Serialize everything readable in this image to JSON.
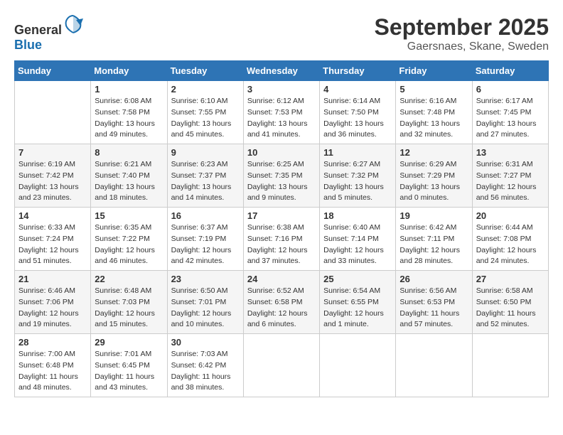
{
  "header": {
    "logo_general": "General",
    "logo_blue": "Blue",
    "month": "September 2025",
    "location": "Gaersnaes, Skane, Sweden"
  },
  "days_of_week": [
    "Sunday",
    "Monday",
    "Tuesday",
    "Wednesday",
    "Thursday",
    "Friday",
    "Saturday"
  ],
  "weeks": [
    [
      {
        "day": "",
        "sunrise": "",
        "sunset": "",
        "daylight": ""
      },
      {
        "day": "1",
        "sunrise": "Sunrise: 6:08 AM",
        "sunset": "Sunset: 7:58 PM",
        "daylight": "Daylight: 13 hours and 49 minutes."
      },
      {
        "day": "2",
        "sunrise": "Sunrise: 6:10 AM",
        "sunset": "Sunset: 7:55 PM",
        "daylight": "Daylight: 13 hours and 45 minutes."
      },
      {
        "day": "3",
        "sunrise": "Sunrise: 6:12 AM",
        "sunset": "Sunset: 7:53 PM",
        "daylight": "Daylight: 13 hours and 41 minutes."
      },
      {
        "day": "4",
        "sunrise": "Sunrise: 6:14 AM",
        "sunset": "Sunset: 7:50 PM",
        "daylight": "Daylight: 13 hours and 36 minutes."
      },
      {
        "day": "5",
        "sunrise": "Sunrise: 6:16 AM",
        "sunset": "Sunset: 7:48 PM",
        "daylight": "Daylight: 13 hours and 32 minutes."
      },
      {
        "day": "6",
        "sunrise": "Sunrise: 6:17 AM",
        "sunset": "Sunset: 7:45 PM",
        "daylight": "Daylight: 13 hours and 27 minutes."
      }
    ],
    [
      {
        "day": "7",
        "sunrise": "Sunrise: 6:19 AM",
        "sunset": "Sunset: 7:42 PM",
        "daylight": "Daylight: 13 hours and 23 minutes."
      },
      {
        "day": "8",
        "sunrise": "Sunrise: 6:21 AM",
        "sunset": "Sunset: 7:40 PM",
        "daylight": "Daylight: 13 hours and 18 minutes."
      },
      {
        "day": "9",
        "sunrise": "Sunrise: 6:23 AM",
        "sunset": "Sunset: 7:37 PM",
        "daylight": "Daylight: 13 hours and 14 minutes."
      },
      {
        "day": "10",
        "sunrise": "Sunrise: 6:25 AM",
        "sunset": "Sunset: 7:35 PM",
        "daylight": "Daylight: 13 hours and 9 minutes."
      },
      {
        "day": "11",
        "sunrise": "Sunrise: 6:27 AM",
        "sunset": "Sunset: 7:32 PM",
        "daylight": "Daylight: 13 hours and 5 minutes."
      },
      {
        "day": "12",
        "sunrise": "Sunrise: 6:29 AM",
        "sunset": "Sunset: 7:29 PM",
        "daylight": "Daylight: 13 hours and 0 minutes."
      },
      {
        "day": "13",
        "sunrise": "Sunrise: 6:31 AM",
        "sunset": "Sunset: 7:27 PM",
        "daylight": "Daylight: 12 hours and 56 minutes."
      }
    ],
    [
      {
        "day": "14",
        "sunrise": "Sunrise: 6:33 AM",
        "sunset": "Sunset: 7:24 PM",
        "daylight": "Daylight: 12 hours and 51 minutes."
      },
      {
        "day": "15",
        "sunrise": "Sunrise: 6:35 AM",
        "sunset": "Sunset: 7:22 PM",
        "daylight": "Daylight: 12 hours and 46 minutes."
      },
      {
        "day": "16",
        "sunrise": "Sunrise: 6:37 AM",
        "sunset": "Sunset: 7:19 PM",
        "daylight": "Daylight: 12 hours and 42 minutes."
      },
      {
        "day": "17",
        "sunrise": "Sunrise: 6:38 AM",
        "sunset": "Sunset: 7:16 PM",
        "daylight": "Daylight: 12 hours and 37 minutes."
      },
      {
        "day": "18",
        "sunrise": "Sunrise: 6:40 AM",
        "sunset": "Sunset: 7:14 PM",
        "daylight": "Daylight: 12 hours and 33 minutes."
      },
      {
        "day": "19",
        "sunrise": "Sunrise: 6:42 AM",
        "sunset": "Sunset: 7:11 PM",
        "daylight": "Daylight: 12 hours and 28 minutes."
      },
      {
        "day": "20",
        "sunrise": "Sunrise: 6:44 AM",
        "sunset": "Sunset: 7:08 PM",
        "daylight": "Daylight: 12 hours and 24 minutes."
      }
    ],
    [
      {
        "day": "21",
        "sunrise": "Sunrise: 6:46 AM",
        "sunset": "Sunset: 7:06 PM",
        "daylight": "Daylight: 12 hours and 19 minutes."
      },
      {
        "day": "22",
        "sunrise": "Sunrise: 6:48 AM",
        "sunset": "Sunset: 7:03 PM",
        "daylight": "Daylight: 12 hours and 15 minutes."
      },
      {
        "day": "23",
        "sunrise": "Sunrise: 6:50 AM",
        "sunset": "Sunset: 7:01 PM",
        "daylight": "Daylight: 12 hours and 10 minutes."
      },
      {
        "day": "24",
        "sunrise": "Sunrise: 6:52 AM",
        "sunset": "Sunset: 6:58 PM",
        "daylight": "Daylight: 12 hours and 6 minutes."
      },
      {
        "day": "25",
        "sunrise": "Sunrise: 6:54 AM",
        "sunset": "Sunset: 6:55 PM",
        "daylight": "Daylight: 12 hours and 1 minute."
      },
      {
        "day": "26",
        "sunrise": "Sunrise: 6:56 AM",
        "sunset": "Sunset: 6:53 PM",
        "daylight": "Daylight: 11 hours and 57 minutes."
      },
      {
        "day": "27",
        "sunrise": "Sunrise: 6:58 AM",
        "sunset": "Sunset: 6:50 PM",
        "daylight": "Daylight: 11 hours and 52 minutes."
      }
    ],
    [
      {
        "day": "28",
        "sunrise": "Sunrise: 7:00 AM",
        "sunset": "Sunset: 6:48 PM",
        "daylight": "Daylight: 11 hours and 48 minutes."
      },
      {
        "day": "29",
        "sunrise": "Sunrise: 7:01 AM",
        "sunset": "Sunset: 6:45 PM",
        "daylight": "Daylight: 11 hours and 43 minutes."
      },
      {
        "day": "30",
        "sunrise": "Sunrise: 7:03 AM",
        "sunset": "Sunset: 6:42 PM",
        "daylight": "Daylight: 11 hours and 38 minutes."
      },
      {
        "day": "",
        "sunrise": "",
        "sunset": "",
        "daylight": ""
      },
      {
        "day": "",
        "sunrise": "",
        "sunset": "",
        "daylight": ""
      },
      {
        "day": "",
        "sunrise": "",
        "sunset": "",
        "daylight": ""
      },
      {
        "day": "",
        "sunrise": "",
        "sunset": "",
        "daylight": ""
      }
    ]
  ]
}
